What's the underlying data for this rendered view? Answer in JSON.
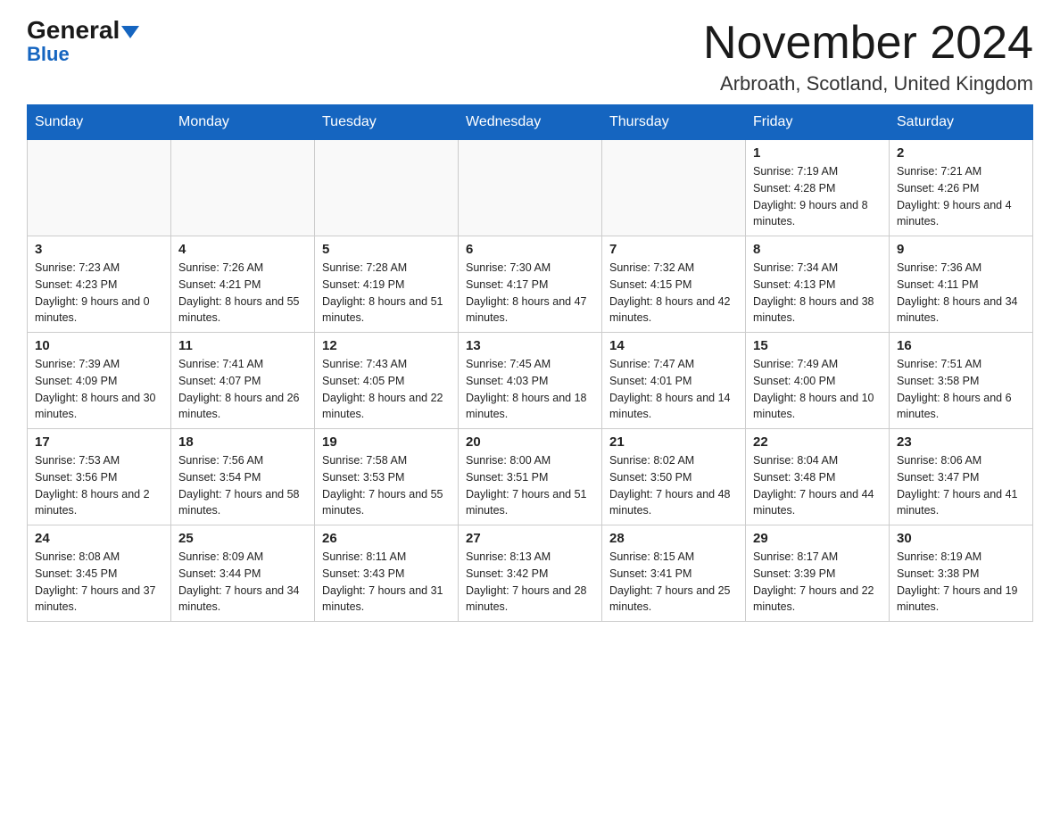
{
  "header": {
    "logo_general": "General",
    "logo_blue": "Blue",
    "month_title": "November 2024",
    "location": "Arbroath, Scotland, United Kingdom"
  },
  "days_of_week": [
    "Sunday",
    "Monday",
    "Tuesday",
    "Wednesday",
    "Thursday",
    "Friday",
    "Saturday"
  ],
  "weeks": [
    [
      {
        "day": "",
        "info": ""
      },
      {
        "day": "",
        "info": ""
      },
      {
        "day": "",
        "info": ""
      },
      {
        "day": "",
        "info": ""
      },
      {
        "day": "",
        "info": ""
      },
      {
        "day": "1",
        "info": "Sunrise: 7:19 AM\nSunset: 4:28 PM\nDaylight: 9 hours and 8 minutes."
      },
      {
        "day": "2",
        "info": "Sunrise: 7:21 AM\nSunset: 4:26 PM\nDaylight: 9 hours and 4 minutes."
      }
    ],
    [
      {
        "day": "3",
        "info": "Sunrise: 7:23 AM\nSunset: 4:23 PM\nDaylight: 9 hours and 0 minutes."
      },
      {
        "day": "4",
        "info": "Sunrise: 7:26 AM\nSunset: 4:21 PM\nDaylight: 8 hours and 55 minutes."
      },
      {
        "day": "5",
        "info": "Sunrise: 7:28 AM\nSunset: 4:19 PM\nDaylight: 8 hours and 51 minutes."
      },
      {
        "day": "6",
        "info": "Sunrise: 7:30 AM\nSunset: 4:17 PM\nDaylight: 8 hours and 47 minutes."
      },
      {
        "day": "7",
        "info": "Sunrise: 7:32 AM\nSunset: 4:15 PM\nDaylight: 8 hours and 42 minutes."
      },
      {
        "day": "8",
        "info": "Sunrise: 7:34 AM\nSunset: 4:13 PM\nDaylight: 8 hours and 38 minutes."
      },
      {
        "day": "9",
        "info": "Sunrise: 7:36 AM\nSunset: 4:11 PM\nDaylight: 8 hours and 34 minutes."
      }
    ],
    [
      {
        "day": "10",
        "info": "Sunrise: 7:39 AM\nSunset: 4:09 PM\nDaylight: 8 hours and 30 minutes."
      },
      {
        "day": "11",
        "info": "Sunrise: 7:41 AM\nSunset: 4:07 PM\nDaylight: 8 hours and 26 minutes."
      },
      {
        "day": "12",
        "info": "Sunrise: 7:43 AM\nSunset: 4:05 PM\nDaylight: 8 hours and 22 minutes."
      },
      {
        "day": "13",
        "info": "Sunrise: 7:45 AM\nSunset: 4:03 PM\nDaylight: 8 hours and 18 minutes."
      },
      {
        "day": "14",
        "info": "Sunrise: 7:47 AM\nSunset: 4:01 PM\nDaylight: 8 hours and 14 minutes."
      },
      {
        "day": "15",
        "info": "Sunrise: 7:49 AM\nSunset: 4:00 PM\nDaylight: 8 hours and 10 minutes."
      },
      {
        "day": "16",
        "info": "Sunrise: 7:51 AM\nSunset: 3:58 PM\nDaylight: 8 hours and 6 minutes."
      }
    ],
    [
      {
        "day": "17",
        "info": "Sunrise: 7:53 AM\nSunset: 3:56 PM\nDaylight: 8 hours and 2 minutes."
      },
      {
        "day": "18",
        "info": "Sunrise: 7:56 AM\nSunset: 3:54 PM\nDaylight: 7 hours and 58 minutes."
      },
      {
        "day": "19",
        "info": "Sunrise: 7:58 AM\nSunset: 3:53 PM\nDaylight: 7 hours and 55 minutes."
      },
      {
        "day": "20",
        "info": "Sunrise: 8:00 AM\nSunset: 3:51 PM\nDaylight: 7 hours and 51 minutes."
      },
      {
        "day": "21",
        "info": "Sunrise: 8:02 AM\nSunset: 3:50 PM\nDaylight: 7 hours and 48 minutes."
      },
      {
        "day": "22",
        "info": "Sunrise: 8:04 AM\nSunset: 3:48 PM\nDaylight: 7 hours and 44 minutes."
      },
      {
        "day": "23",
        "info": "Sunrise: 8:06 AM\nSunset: 3:47 PM\nDaylight: 7 hours and 41 minutes."
      }
    ],
    [
      {
        "day": "24",
        "info": "Sunrise: 8:08 AM\nSunset: 3:45 PM\nDaylight: 7 hours and 37 minutes."
      },
      {
        "day": "25",
        "info": "Sunrise: 8:09 AM\nSunset: 3:44 PM\nDaylight: 7 hours and 34 minutes."
      },
      {
        "day": "26",
        "info": "Sunrise: 8:11 AM\nSunset: 3:43 PM\nDaylight: 7 hours and 31 minutes."
      },
      {
        "day": "27",
        "info": "Sunrise: 8:13 AM\nSunset: 3:42 PM\nDaylight: 7 hours and 28 minutes."
      },
      {
        "day": "28",
        "info": "Sunrise: 8:15 AM\nSunset: 3:41 PM\nDaylight: 7 hours and 25 minutes."
      },
      {
        "day": "29",
        "info": "Sunrise: 8:17 AM\nSunset: 3:39 PM\nDaylight: 7 hours and 22 minutes."
      },
      {
        "day": "30",
        "info": "Sunrise: 8:19 AM\nSunset: 3:38 PM\nDaylight: 7 hours and 19 minutes."
      }
    ]
  ]
}
